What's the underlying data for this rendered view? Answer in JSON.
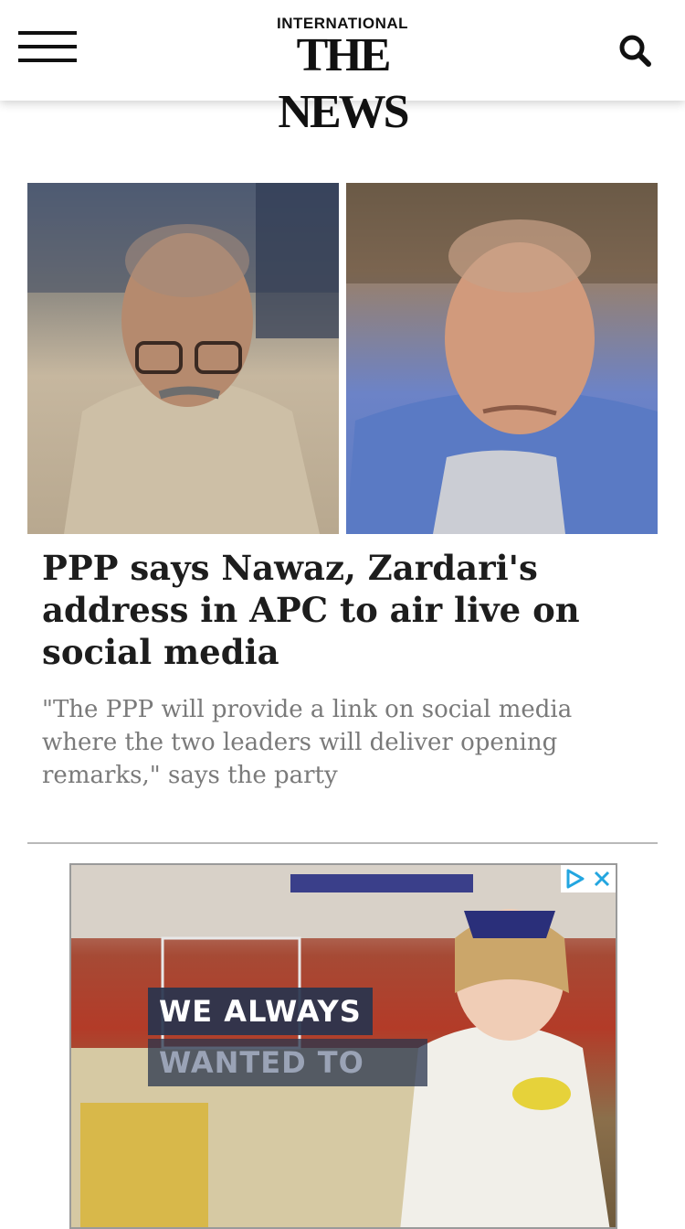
{
  "header": {
    "logo_top": "INTERNATIONAL",
    "logo_main": "THE NEWS",
    "menu_icon": "hamburger-menu-icon",
    "search_icon": "search-icon"
  },
  "article": {
    "headline": "PPP says Nawaz, Zardari's address in APC to air live on social media",
    "summary": "\"The PPP will provide a link on social media where the two leaders will deliver opening remarks,\" says the party"
  },
  "ad": {
    "line1": "WE ALWAYS",
    "line2": "WANTED TO",
    "choices_icon": "ad-choices-icon",
    "close_icon": "close-icon"
  },
  "colors": {
    "headline": "#1d1d1d",
    "summary": "#7a7a7a",
    "divider": "#b9b9b9"
  }
}
